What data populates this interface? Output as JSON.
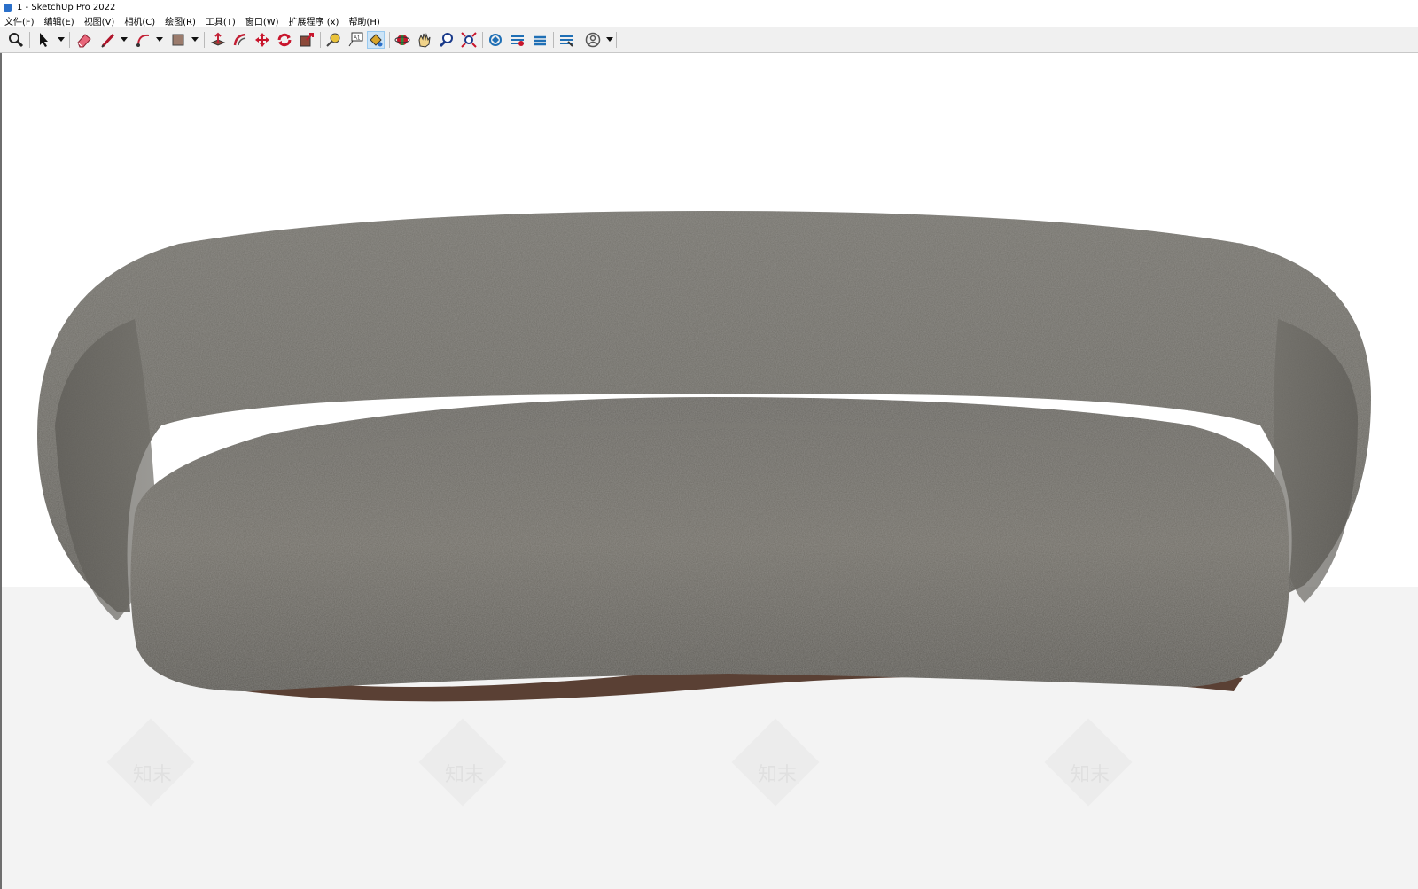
{
  "window": {
    "title": "1 - SketchUp Pro 2022"
  },
  "menu": [
    {
      "label": "文件(F)"
    },
    {
      "label": "编辑(E)"
    },
    {
      "label": "视图(V)"
    },
    {
      "label": "相机(C)"
    },
    {
      "label": "绘图(R)"
    },
    {
      "label": "工具(T)"
    },
    {
      "label": "窗口(W)"
    },
    {
      "label": "扩展程序 (x)"
    },
    {
      "label": "帮助(H)"
    }
  ],
  "toolbar": {
    "tools": [
      {
        "name": "zoom-icon"
      },
      {
        "name": "select-icon"
      },
      {
        "name": "eraser-icon"
      },
      {
        "name": "pencil-line-icon"
      },
      {
        "name": "arc-icon"
      },
      {
        "name": "rectangle-icon"
      },
      {
        "name": "push-pull-icon"
      },
      {
        "name": "offset-icon"
      },
      {
        "name": "move-icon"
      },
      {
        "name": "rotate-icon"
      },
      {
        "name": "scale-icon"
      },
      {
        "name": "tape-measure-icon"
      },
      {
        "name": "text-icon"
      },
      {
        "name": "paint-bucket-icon"
      },
      {
        "name": "orbit-icon"
      },
      {
        "name": "pan-icon"
      },
      {
        "name": "zoom-window-icon"
      },
      {
        "name": "zoom-extents-icon"
      },
      {
        "name": "warehouse-icon"
      },
      {
        "name": "extension-warehouse-icon"
      },
      {
        "name": "layout-icon"
      },
      {
        "name": "extension-manager-icon"
      },
      {
        "name": "account-icon"
      }
    ],
    "active_tool": "paint-bucket-icon"
  },
  "viewport": {
    "model": "sofa",
    "watermark_text": "知末"
  },
  "colors": {
    "sofa_fabric": "#6d6b66",
    "sofa_base": "#5a4034",
    "ground": "#f3f3f3"
  }
}
